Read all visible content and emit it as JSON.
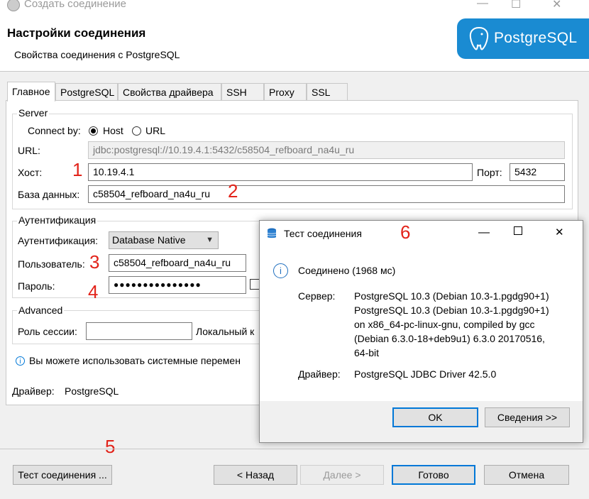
{
  "window": {
    "title": "Создать соединение"
  },
  "header": {
    "title": "Настройки соединения",
    "subtitle": "Свойства соединения с PostgreSQL",
    "logo_text": "PostgreSQL"
  },
  "tabs": [
    {
      "label": "Главное"
    },
    {
      "label": "PostgreSQL"
    },
    {
      "label": "Свойства драйвера"
    },
    {
      "label": "SSH"
    },
    {
      "label": "Proxy"
    },
    {
      "label": "SSL"
    }
  ],
  "server": {
    "legend": "Server",
    "connect_by_label": "Connect by:",
    "opt_host": "Host",
    "opt_url": "URL",
    "url_label": "URL:",
    "url_value": "jdbc:postgresql://10.19.4.1:5432/c58504_refboard_na4u_ru",
    "host_label": "Хост:",
    "host_value": "10.19.4.1",
    "port_label": "Порт:",
    "port_value": "5432",
    "db_label": "База данных:",
    "db_value": "c58504_refboard_na4u_ru"
  },
  "auth": {
    "legend": "Аутентификация",
    "auth_label": "Аутентификация:",
    "auth_value": "Database Native",
    "user_label": "Пользователь:",
    "user_value": "c58504_refboard_na4u_ru",
    "password_label": "Пароль:",
    "password_value": "●●●●●●●●●●●●●●●"
  },
  "advanced": {
    "legend": "Advanced",
    "session_role_label": "Роль сессии:",
    "local_label": "Локальный к"
  },
  "info_text": "Вы можете использовать системные перемен",
  "driver": {
    "label": "Драйвер:",
    "value": "PostgreSQL"
  },
  "buttons": {
    "test": "Тест соединения ...",
    "back": "< Назад",
    "next": "Далее >",
    "finish": "Готово",
    "cancel": "Отмена"
  },
  "annotations": [
    "1",
    "2",
    "3",
    "4",
    "5",
    "6"
  ],
  "dialog": {
    "title": "Тест соединения",
    "message": "Соединено (1968 мс)",
    "server_label": "Сервер:",
    "server_lines": [
      "PostgreSQL 10.3 (Debian 10.3-1.pgdg90+1)",
      "PostgreSQL 10.3 (Debian 10.3-1.pgdg90+1)",
      "on x86_64-pc-linux-gnu, compiled by gcc",
      "(Debian 6.3.0-18+deb9u1) 6.3.0 20170516,",
      "64-bit"
    ],
    "driver_label": "Драйвер:",
    "driver_value": "PostgreSQL JDBC Driver 42.5.0",
    "ok": "OK",
    "details": "Сведения >>"
  },
  "colors": {
    "accent": "#0078d7",
    "logo_bg": "#1a8bd2",
    "annotation": "#e2231a"
  }
}
